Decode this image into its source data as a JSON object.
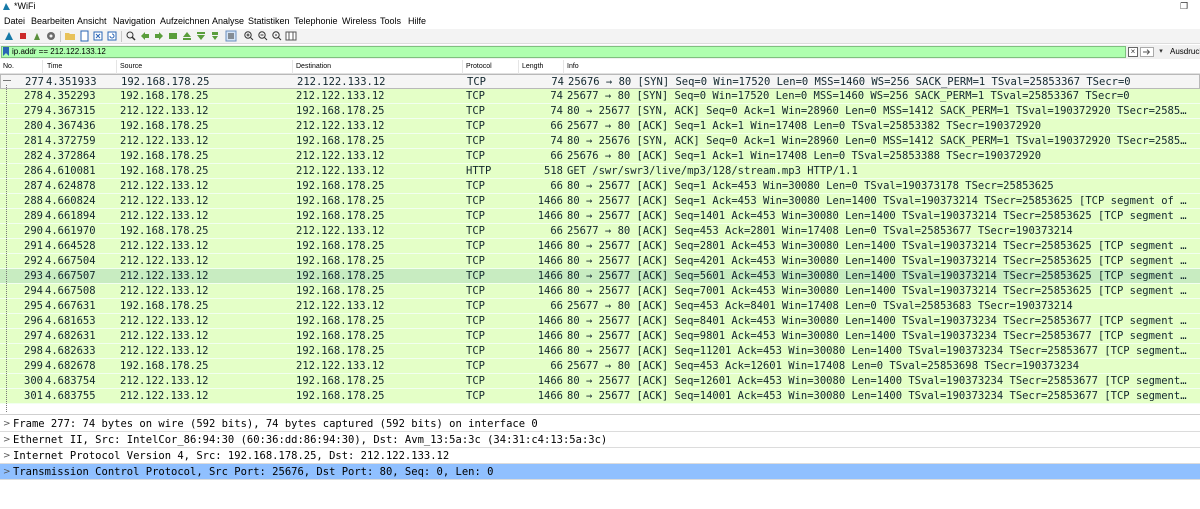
{
  "window": {
    "title": "*WiFi",
    "restore_glyph": "❐"
  },
  "menu": [
    "Datei",
    "Bearbeiten",
    "Ansicht",
    "Navigation",
    "Aufzeichnen",
    "Analyse",
    "Statistiken",
    "Telephonie",
    "Wireless",
    "Tools",
    "Hilfe"
  ],
  "toolbar_icons": [
    "shark-fin-start-icon",
    "stop-square-icon",
    "restart-icon",
    "options-gear-icon",
    "open-folder-icon",
    "file-icon",
    "close-file-icon",
    "reload-icon",
    "find-icon",
    "go-back-icon",
    "go-forward-icon",
    "go-to-packet-icon",
    "go-first-icon",
    "go-last-icon",
    "autoscroll-icon",
    "colorize-icon",
    "zoom-in-icon",
    "zoom-out-icon",
    "zoom-normal-icon",
    "resize-columns-icon"
  ],
  "filter": {
    "value": "ip.addr == 212.122.133.12",
    "clear_glyph": "×",
    "dropdown_glyph": "▾",
    "expression_label": "Ausdruck..."
  },
  "columns": {
    "no": "No.",
    "time": "Time",
    "source": "Source",
    "destination": "Destination",
    "protocol": "Protocol",
    "length": "Length",
    "info": "Info"
  },
  "packets": [
    {
      "no": "277",
      "time": "4.351933",
      "src": "192.168.178.25",
      "dst": "212.122.133.12",
      "proto": "TCP",
      "len": "74",
      "info": "25676 → 80 [SYN] Seq=0 Win=17520 Len=0 MSS=1460 WS=256 SACK_PERM=1 TSval=25853367 TSecr=0"
    },
    {
      "no": "278",
      "time": "4.352293",
      "src": "192.168.178.25",
      "dst": "212.122.133.12",
      "proto": "TCP",
      "len": "74",
      "info": "25677 → 80 [SYN] Seq=0 Win=17520 Len=0 MSS=1460 WS=256 SACK_PERM=1 TSval=25853367 TSecr=0"
    },
    {
      "no": "279",
      "time": "4.367315",
      "src": "212.122.133.12",
      "dst": "192.168.178.25",
      "proto": "TCP",
      "len": "74",
      "info": "80 → 25677 [SYN, ACK] Seq=0 Ack=1 Win=28960 Len=0 MSS=1412 SACK_PERM=1 TSval=190372920 TSecr=2585…"
    },
    {
      "no": "280",
      "time": "4.367436",
      "src": "192.168.178.25",
      "dst": "212.122.133.12",
      "proto": "TCP",
      "len": "66",
      "info": "25677 → 80 [ACK] Seq=1 Ack=1 Win=17408 Len=0 TSval=25853382 TSecr=190372920"
    },
    {
      "no": "281",
      "time": "4.372759",
      "src": "212.122.133.12",
      "dst": "192.168.178.25",
      "proto": "TCP",
      "len": "74",
      "info": "80 → 25676 [SYN, ACK] Seq=0 Ack=1 Win=28960 Len=0 MSS=1412 SACK_PERM=1 TSval=190372920 TSecr=2585…"
    },
    {
      "no": "282",
      "time": "4.372864",
      "src": "192.168.178.25",
      "dst": "212.122.133.12",
      "proto": "TCP",
      "len": "66",
      "info": "25676 → 80 [ACK] Seq=1 Ack=1 Win=17408 Len=0 TSval=25853388 TSecr=190372920"
    },
    {
      "no": "286",
      "time": "4.610081",
      "src": "192.168.178.25",
      "dst": "212.122.133.12",
      "proto": "HTTP",
      "len": "518",
      "info": "GET /swr/swr3/live/mp3/128/stream.mp3 HTTP/1.1"
    },
    {
      "no": "287",
      "time": "4.624878",
      "src": "212.122.133.12",
      "dst": "192.168.178.25",
      "proto": "TCP",
      "len": "66",
      "info": "80 → 25677 [ACK] Seq=1 Ack=453 Win=30080 Len=0 TSval=190373178 TSecr=25853625"
    },
    {
      "no": "288",
      "time": "4.660824",
      "src": "212.122.133.12",
      "dst": "192.168.178.25",
      "proto": "TCP",
      "len": "1466",
      "info": "80 → 25677 [ACK] Seq=1 Ack=453 Win=30080 Len=1400 TSval=190373214 TSecr=25853625 [TCP segment of …"
    },
    {
      "no": "289",
      "time": "4.661894",
      "src": "212.122.133.12",
      "dst": "192.168.178.25",
      "proto": "TCP",
      "len": "1466",
      "info": "80 → 25677 [ACK] Seq=1401 Ack=453 Win=30080 Len=1400 TSval=190373214 TSecr=25853625 [TCP segment …"
    },
    {
      "no": "290",
      "time": "4.661970",
      "src": "192.168.178.25",
      "dst": "212.122.133.12",
      "proto": "TCP",
      "len": "66",
      "info": "25677 → 80 [ACK] Seq=453 Ack=2801 Win=17408 Len=0 TSval=25853677 TSecr=190373214"
    },
    {
      "no": "291",
      "time": "4.664528",
      "src": "212.122.133.12",
      "dst": "192.168.178.25",
      "proto": "TCP",
      "len": "1466",
      "info": "80 → 25677 [ACK] Seq=2801 Ack=453 Win=30080 Len=1400 TSval=190373214 TSecr=25853625 [TCP segment …"
    },
    {
      "no": "292",
      "time": "4.667504",
      "src": "212.122.133.12",
      "dst": "192.168.178.25",
      "proto": "TCP",
      "len": "1466",
      "info": "80 → 25677 [ACK] Seq=4201 Ack=453 Win=30080 Len=1400 TSval=190373214 TSecr=25853625 [TCP segment …"
    },
    {
      "no": "293",
      "time": "4.667507",
      "src": "212.122.133.12",
      "dst": "192.168.178.25",
      "proto": "TCP",
      "len": "1466",
      "info": "80 → 25677 [ACK] Seq=5601 Ack=453 Win=30080 Len=1400 TSval=190373214 TSecr=25853625 [TCP segment …"
    },
    {
      "no": "294",
      "time": "4.667508",
      "src": "212.122.133.12",
      "dst": "192.168.178.25",
      "proto": "TCP",
      "len": "1466",
      "info": "80 → 25677 [ACK] Seq=7001 Ack=453 Win=30080 Len=1400 TSval=190373214 TSecr=25853625 [TCP segment …"
    },
    {
      "no": "295",
      "time": "4.667631",
      "src": "192.168.178.25",
      "dst": "212.122.133.12",
      "proto": "TCP",
      "len": "66",
      "info": "25677 → 80 [ACK] Seq=453 Ack=8401 Win=17408 Len=0 TSval=25853683 TSecr=190373214"
    },
    {
      "no": "296",
      "time": "4.681653",
      "src": "212.122.133.12",
      "dst": "192.168.178.25",
      "proto": "TCP",
      "len": "1466",
      "info": "80 → 25677 [ACK] Seq=8401 Ack=453 Win=30080 Len=1400 TSval=190373234 TSecr=25853677 [TCP segment …"
    },
    {
      "no": "297",
      "time": "4.682631",
      "src": "212.122.133.12",
      "dst": "192.168.178.25",
      "proto": "TCP",
      "len": "1466",
      "info": "80 → 25677 [ACK] Seq=9801 Ack=453 Win=30080 Len=1400 TSval=190373234 TSecr=25853677 [TCP segment …"
    },
    {
      "no": "298",
      "time": "4.682633",
      "src": "212.122.133.12",
      "dst": "192.168.178.25",
      "proto": "TCP",
      "len": "1466",
      "info": "80 → 25677 [ACK] Seq=11201 Ack=453 Win=30080 Len=1400 TSval=190373234 TSecr=25853677 [TCP segment…"
    },
    {
      "no": "299",
      "time": "4.682678",
      "src": "192.168.178.25",
      "dst": "212.122.133.12",
      "proto": "TCP",
      "len": "66",
      "info": "25677 → 80 [ACK] Seq=453 Ack=12601 Win=17408 Len=0 TSval=25853698 TSecr=190373234"
    },
    {
      "no": "300",
      "time": "4.683754",
      "src": "212.122.133.12",
      "dst": "192.168.178.25",
      "proto": "TCP",
      "len": "1466",
      "info": "80 → 25677 [ACK] Seq=12601 Ack=453 Win=30080 Len=1400 TSval=190373234 TSecr=25853677 [TCP segment…"
    },
    {
      "no": "301",
      "time": "4.683755",
      "src": "212.122.133.12",
      "dst": "192.168.178.25",
      "proto": "TCP",
      "len": "1466",
      "info": "80 → 25677 [ACK] Seq=14001 Ack=453 Win=30080 Len=1400 TSval=190373234 TSecr=25853677 [TCP segment…"
    }
  ],
  "details": [
    "Frame 277: 74 bytes on wire (592 bits), 74 bytes captured (592 bits) on interface 0",
    "Ethernet II, Src: IntelCor_86:94:30 (60:36:dd:86:94:30), Dst: Avm_13:5a:3c (34:31:c4:13:5a:3c)",
    "Internet Protocol Version 4, Src: 192.168.178.25, Dst: 212.122.133.12",
    "Transmission Control Protocol, Src Port: 25676, Dst Port: 80, Seq: 0, Len: 0"
  ],
  "detail_arrow": ">",
  "colors": {
    "tcp_row": "#e4ffc7",
    "filter_valid": "#afffaf",
    "detail_selected": "#90c0ff",
    "hover_row": "#c8ecc1"
  }
}
